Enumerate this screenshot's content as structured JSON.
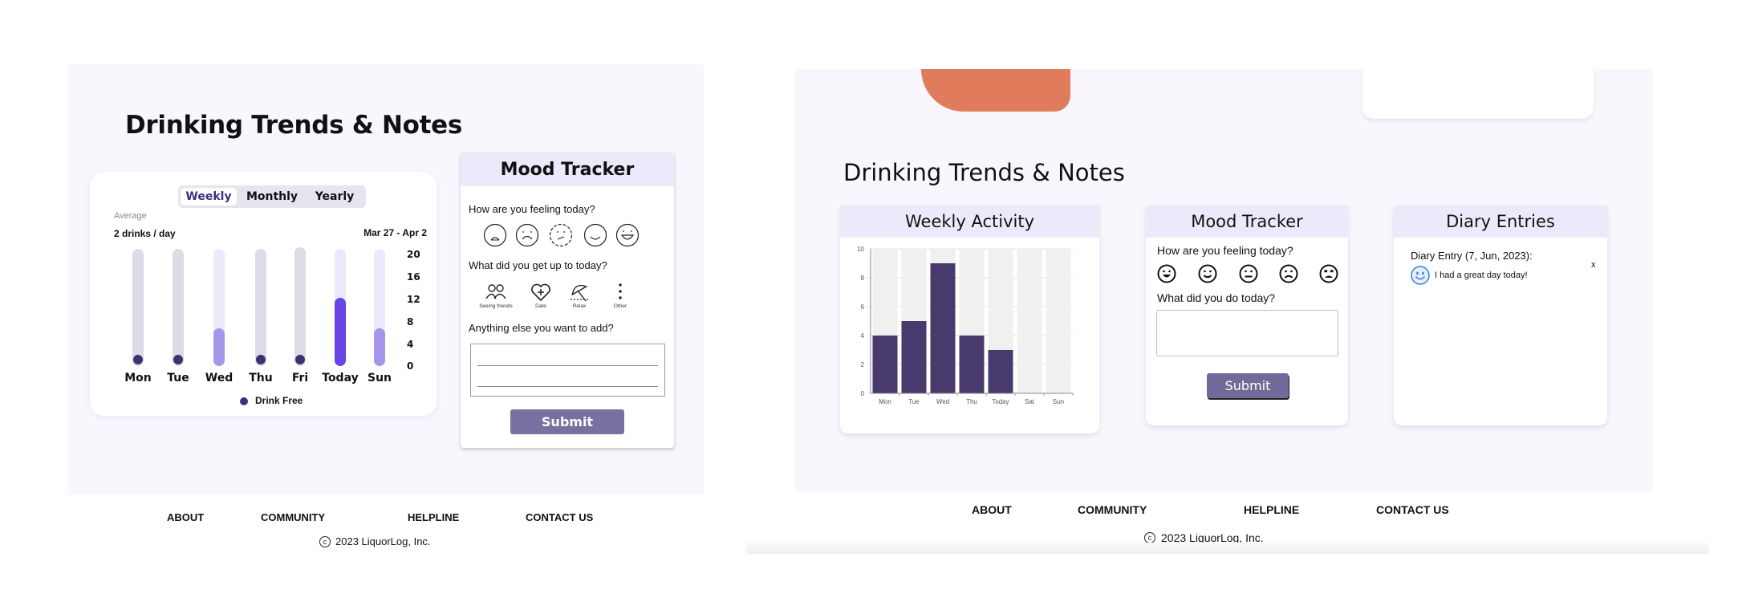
{
  "left": {
    "title": "Drinking Trends & Notes",
    "trends": {
      "tabs": [
        "Weekly",
        "Monthly",
        "Yearly"
      ],
      "active_tab": "Weekly",
      "average_label": "Average",
      "average_value": "2 drinks / day",
      "date_range": "Mar 27 - Apr 2",
      "y_ticks": [
        "20",
        "16",
        "12",
        "8",
        "4",
        "0"
      ],
      "days": [
        "Mon",
        "Tue",
        "Wed",
        "Thu",
        "Fri",
        "Today",
        "Sun"
      ],
      "values": [
        0,
        0,
        5,
        0,
        0,
        9,
        5
      ],
      "legend": "Drink Free"
    },
    "mood": {
      "title": "Mood Tracker",
      "q_feeling": "How are you feeling today?",
      "q_activity": "What did you get up to today?",
      "activities": [
        "Seeing friends",
        "Date",
        "Relax",
        "Other"
      ],
      "q_notes": "Anything else you want to add?",
      "submit": "Submit"
    },
    "footer": {
      "links": [
        "ABOUT",
        "COMMUNITY",
        "HELPLINE",
        "CONTACT US"
      ],
      "copyright_symbol": "c",
      "copyright": "2023 LiquorLog, Inc."
    }
  },
  "right": {
    "title": "Drinking Trends & Notes",
    "weekly": {
      "title": "Weekly Activity",
      "chart_data": {
        "type": "bar",
        "categories": [
          "Mon",
          "Tue",
          "Wed",
          "Thu",
          "Today",
          "Sat",
          "Sun"
        ],
        "values": [
          4,
          5,
          9,
          4,
          3,
          0,
          0
        ],
        "ylim": [
          0,
          10
        ],
        "y_ticks": [
          "0",
          "2",
          "4",
          "6",
          "8",
          "10"
        ],
        "grid": true,
        "bar_color": "#493a6e",
        "track_color": "#f0f0f0"
      }
    },
    "mood": {
      "title": "Mood Tracker",
      "q_feeling": "How are you feeling today?",
      "q_activity": "What did you do today?",
      "submit": "Submit"
    },
    "diary": {
      "title": "Diary Entries",
      "entry_title": "Diary Entry (7, Jun, 2023):",
      "entry_text": "I had a great day today!",
      "close": "x"
    },
    "footer": {
      "links": [
        "ABOUT",
        "COMMUNITY",
        "HELPLINE",
        "CONTACT US"
      ],
      "copyright_symbol": "c",
      "copyright": "2023 LiquorLog, Inc."
    }
  },
  "colors": {
    "panel_bg": "#f9f7fd",
    "header_bg": "#ece9fb",
    "accent_dark": "#3c3272",
    "button": "#7a6fa1",
    "blob": "#e07c5c"
  }
}
